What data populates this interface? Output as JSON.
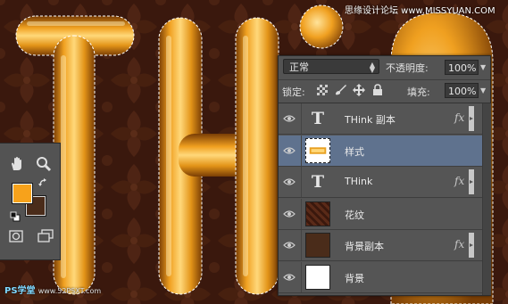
{
  "colors": {
    "background_fabric": "#3a180d",
    "gold_light": "#ffd87a",
    "gold_mid": "#f0a020",
    "gold_dark": "#8a4a06",
    "panel": "#535353",
    "selected_row": "#5f728e",
    "foreground_color": "#f7a21b",
    "background_color": "#4a2c1a"
  },
  "watermark": {
    "top_right": "思缘设计论坛 www.MISSYUAN.COM",
    "bottom_left_ps": "PS学堂",
    "bottom_left_site": "www.52PSXT.com"
  },
  "layers_panel": {
    "blend_mode": "正常",
    "opacity_label": "不透明度:",
    "opacity_value": "100%",
    "lock_label": "锁定:",
    "fill_label": "填充:",
    "fill_value": "100%",
    "lock_icons": [
      "lock-transparent-icon",
      "lock-brush-icon",
      "lock-move-icon",
      "lock-all-icon"
    ],
    "layers": [
      {
        "name": "THink 副本",
        "thumb": "text",
        "fx": "fx",
        "selected": false
      },
      {
        "name": "样式",
        "thumb": "style-image",
        "fx": "",
        "selected": true
      },
      {
        "name": "THink",
        "thumb": "text",
        "fx": "fx",
        "selected": false
      },
      {
        "name": "花纹",
        "thumb": "pattern",
        "fx": "",
        "selected": false
      },
      {
        "name": "背景副本",
        "thumb": "brown-fill",
        "fx": "fx",
        "selected": false
      },
      {
        "name": "背景",
        "thumb": "white-fill",
        "fx": "",
        "selected": false
      }
    ]
  },
  "tools_panel": {
    "tools": [
      "hand-tool-icon",
      "zoom-tool-icon",
      "swap-colors-icon",
      "default-colors-icon",
      "quick-mask-icon",
      "screen-mode-icon"
    ]
  }
}
